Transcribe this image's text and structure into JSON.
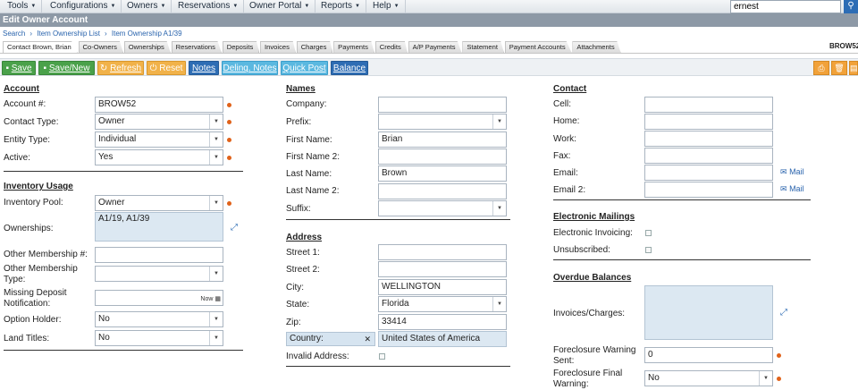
{
  "menu": {
    "items": [
      "Tools",
      "Configurations",
      "Owners",
      "Reservations",
      "Owner Portal",
      "Reports",
      "Help"
    ],
    "search_value": "ernest"
  },
  "title": "Edit Owner Account",
  "breadcrumb": [
    "Search",
    "Item Ownership List",
    "Item Ownership A1/39"
  ],
  "tabs": [
    "Contact Brown, Brian",
    "Co-Owners",
    "Ownerships",
    "Reservations",
    "Deposits",
    "Invoices",
    "Charges",
    "Payments",
    "Credits",
    "A/P Payments",
    "Statement",
    "Payment Accounts",
    "Attachments"
  ],
  "record_code": "BROW52",
  "toolbar": {
    "save": "Save",
    "save_new": "Save/New",
    "refresh": "Refresh",
    "reset": "Reset",
    "notes": "Notes",
    "delinq_notes": "Delinq. Notes",
    "quick_post": "Quick Post",
    "balance": "Balance"
  },
  "account": {
    "title": "Account",
    "account_no_label": "Account #:",
    "account_no": "BROW52",
    "contact_type_label": "Contact Type:",
    "contact_type": "Owner",
    "entity_type_label": "Entity Type:",
    "entity_type": "Individual",
    "active_label": "Active:",
    "active": "Yes"
  },
  "inventory": {
    "title": "Inventory Usage",
    "pool_label": "Inventory Pool:",
    "pool": "Owner",
    "ownerships_label": "Ownerships:",
    "ownerships": "A1/19, A1/39",
    "other_membership_no_label": "Other Membership #:",
    "other_membership_type_label": "Other Membership Type:",
    "missing_deposit_label": "Missing Deposit Notification:",
    "now_label": "Now",
    "option_holder_label": "Option Holder:",
    "option_holder": "No",
    "land_titles_label": "Land Titles:",
    "land_titles": "No"
  },
  "names": {
    "title": "Names",
    "company_label": "Company:",
    "prefix_label": "Prefix:",
    "first_name_label": "First Name:",
    "first_name": "Brian",
    "first_name2_label": "First Name 2:",
    "last_name_label": "Last Name:",
    "last_name": "Brown",
    "last_name2_label": "Last Name 2:",
    "suffix_label": "Suffix:"
  },
  "address": {
    "title": "Address",
    "street1_label": "Street 1:",
    "street2_label": "Street 2:",
    "city_label": "City:",
    "city": "WELLINGTON",
    "state_label": "State:",
    "state": "Florida",
    "zip_label": "Zip:",
    "zip": "33414",
    "country_label": "Country:",
    "country": "United States of America",
    "invalid_label": "Invalid Address:"
  },
  "contact": {
    "title": "Contact",
    "cell_label": "Cell:",
    "home_label": "Home:",
    "work_label": "Work:",
    "fax_label": "Fax:",
    "email_label": "Email:",
    "email2_label": "Email 2:",
    "mail_link": "Mail"
  },
  "mailings": {
    "title": "Electronic Mailings",
    "invoicing_label": "Electronic Invoicing:",
    "unsubscribed_label": "Unsubscribed:"
  },
  "overdue": {
    "title": "Overdue Balances",
    "invoices_label": "Invoices/Charges:",
    "fc_warning_label": "Foreclosure Warning Sent:",
    "fc_warning": "0",
    "fc_final_label": "Foreclosure Final Warning:",
    "fc_final": "No"
  }
}
